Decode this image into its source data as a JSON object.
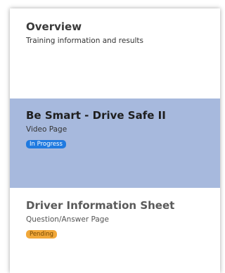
{
  "nav": {
    "items": [
      {
        "title": "Overview",
        "subtitle": "Training information and results",
        "status": "",
        "state": "default"
      },
      {
        "title": "Be Smart - Drive Safe II",
        "subtitle": "Video Page",
        "status": "In Progress",
        "state": "active"
      },
      {
        "title": "Driver Information Sheet",
        "subtitle": "Question/Answer Page",
        "status": "Pending",
        "state": "pending"
      }
    ]
  },
  "colors": {
    "active_bg": "#a7b9dd",
    "in_progress_badge": "#1f7ae0",
    "pending_badge": "#f1a83a"
  }
}
